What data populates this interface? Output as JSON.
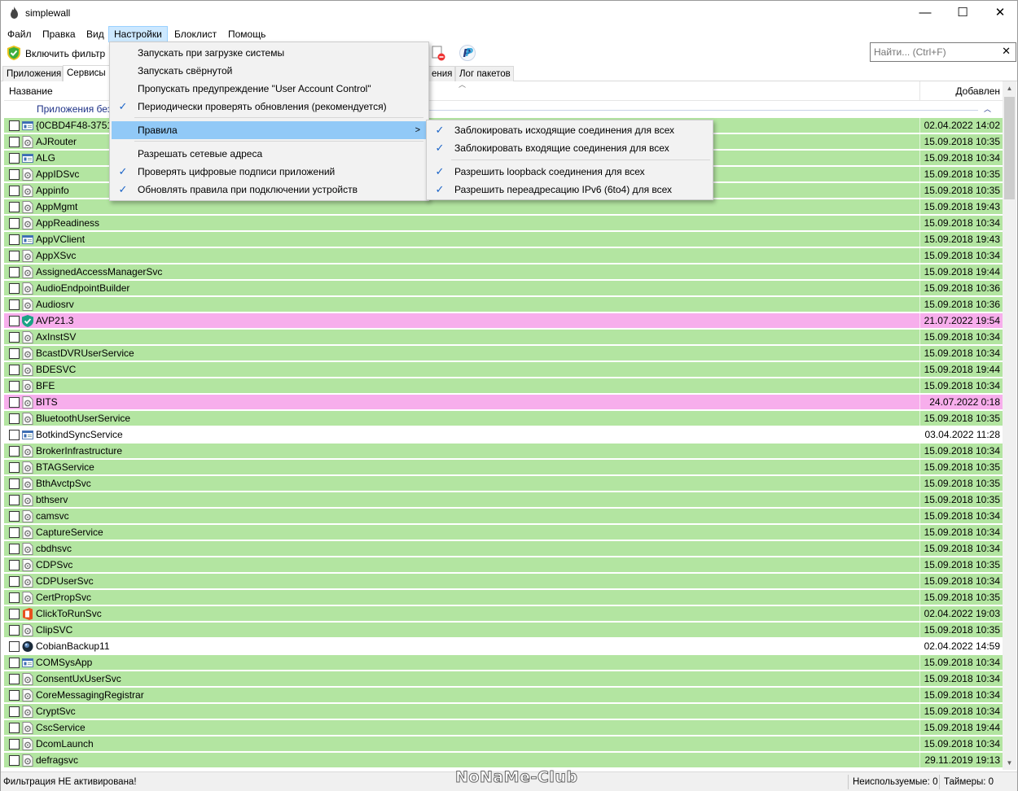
{
  "window": {
    "title": "simplewall",
    "minimize": "—",
    "maximize": "☐",
    "close": "✕"
  },
  "menubar": {
    "items": [
      "Файл",
      "Правка",
      "Вид",
      "Настройки",
      "Блоклист",
      "Помощь"
    ]
  },
  "toolbar": {
    "enable_filter_label": "Включить фильтр",
    "search_placeholder": "Найти... (Ctrl+F)",
    "search_clear": "✕"
  },
  "tabs": [
    "Приложения",
    "Сервисы",
    "ения",
    "Лог пакетов"
  ],
  "list": {
    "col_name": "Название",
    "col_added": "Добавлен",
    "group_title": "Приложения без дос",
    "rows": [
      {
        "name": "{0CBD4F48-3751-",
        "date": "02.04.2022 14:02",
        "color": "green",
        "icon": "window-icon"
      },
      {
        "name": "AJRouter",
        "date": "15.09.2018 10:35",
        "color": "green",
        "icon": "service-icon"
      },
      {
        "name": "ALG",
        "date": "15.09.2018 10:34",
        "color": "green",
        "icon": "window-icon"
      },
      {
        "name": "AppIDSvc",
        "date": "15.09.2018 10:35",
        "color": "green",
        "icon": "service-icon"
      },
      {
        "name": "Appinfo",
        "date": "15.09.2018 10:35",
        "color": "green",
        "icon": "service-icon"
      },
      {
        "name": "AppMgmt",
        "date": "15.09.2018 19:43",
        "color": "green",
        "icon": "service-icon"
      },
      {
        "name": "AppReadiness",
        "date": "15.09.2018 10:34",
        "color": "green",
        "icon": "service-icon"
      },
      {
        "name": "AppVClient",
        "date": "15.09.2018 19:43",
        "color": "green",
        "icon": "window-icon"
      },
      {
        "name": "AppXSvc",
        "date": "15.09.2018 10:34",
        "color": "green",
        "icon": "service-icon"
      },
      {
        "name": "AssignedAccessManagerSvc",
        "date": "15.09.2018 19:44",
        "color": "green",
        "icon": "service-icon"
      },
      {
        "name": "AudioEndpointBuilder",
        "date": "15.09.2018 10:36",
        "color": "green",
        "icon": "service-icon"
      },
      {
        "name": "Audiosrv",
        "date": "15.09.2018 10:36",
        "color": "green",
        "icon": "service-icon"
      },
      {
        "name": "AVP21.3",
        "date": "21.07.2022 19:54",
        "color": "pink",
        "icon": "kaspersky-shield-icon"
      },
      {
        "name": "AxInstSV",
        "date": "15.09.2018 10:34",
        "color": "green",
        "icon": "service-icon"
      },
      {
        "name": "BcastDVRUserService",
        "date": "15.09.2018 10:34",
        "color": "green",
        "icon": "service-icon"
      },
      {
        "name": "BDESVC",
        "date": "15.09.2018 19:44",
        "color": "green",
        "icon": "service-icon"
      },
      {
        "name": "BFE",
        "date": "15.09.2018 10:34",
        "color": "green",
        "icon": "service-icon"
      },
      {
        "name": "BITS",
        "date": "24.07.2022 0:18",
        "color": "pink",
        "icon": "service-icon"
      },
      {
        "name": "BluetoothUserService",
        "date": "15.09.2018 10:35",
        "color": "green",
        "icon": "service-icon"
      },
      {
        "name": "BotkindSyncService",
        "date": "03.04.2022 11:28",
        "color": "white",
        "icon": "window-icon"
      },
      {
        "name": "BrokerInfrastructure",
        "date": "15.09.2018 10:34",
        "color": "green",
        "icon": "service-icon"
      },
      {
        "name": "BTAGService",
        "date": "15.09.2018 10:35",
        "color": "green",
        "icon": "service-icon"
      },
      {
        "name": "BthAvctpSvc",
        "date": "15.09.2018 10:35",
        "color": "green",
        "icon": "service-icon"
      },
      {
        "name": "bthserv",
        "date": "15.09.2018 10:35",
        "color": "green",
        "icon": "service-icon"
      },
      {
        "name": "camsvc",
        "date": "15.09.2018 10:34",
        "color": "green",
        "icon": "service-icon"
      },
      {
        "name": "CaptureService",
        "date": "15.09.2018 10:34",
        "color": "green",
        "icon": "service-icon"
      },
      {
        "name": "cbdhsvc",
        "date": "15.09.2018 10:34",
        "color": "green",
        "icon": "service-icon"
      },
      {
        "name": "CDPSvc",
        "date": "15.09.2018 10:35",
        "color": "green",
        "icon": "service-icon"
      },
      {
        "name": "CDPUserSvc",
        "date": "15.09.2018 10:34",
        "color": "green",
        "icon": "service-icon"
      },
      {
        "name": "CertPropSvc",
        "date": "15.09.2018 10:35",
        "color": "green",
        "icon": "service-icon"
      },
      {
        "name": "ClickToRunSvc",
        "date": "02.04.2022 19:03",
        "color": "green",
        "icon": "office-icon"
      },
      {
        "name": "ClipSVC",
        "date": "15.09.2018 10:35",
        "color": "green",
        "icon": "service-icon"
      },
      {
        "name": "CobianBackup11",
        "date": "02.04.2022 14:59",
        "color": "white",
        "icon": "cobian-icon"
      },
      {
        "name": "COMSysApp",
        "date": "15.09.2018 10:34",
        "color": "green",
        "icon": "window-icon"
      },
      {
        "name": "ConsentUxUserSvc",
        "date": "15.09.2018 10:34",
        "color": "green",
        "icon": "service-icon"
      },
      {
        "name": "CoreMessagingRegistrar",
        "date": "15.09.2018 10:34",
        "color": "green",
        "icon": "service-icon"
      },
      {
        "name": "CryptSvc",
        "date": "15.09.2018 10:34",
        "color": "green",
        "icon": "service-icon"
      },
      {
        "name": "CscService",
        "date": "15.09.2018 19:44",
        "color": "green",
        "icon": "service-icon"
      },
      {
        "name": "DcomLaunch",
        "date": "15.09.2018 10:34",
        "color": "green",
        "icon": "service-icon"
      },
      {
        "name": "defragsvc",
        "date": "29.11.2019 19:13",
        "color": "green",
        "icon": "service-icon"
      }
    ]
  },
  "settings_menu": {
    "items": [
      {
        "label": "Запускать при загрузке системы",
        "checked": false
      },
      {
        "label": "Запускать свёрнутой",
        "checked": false
      },
      {
        "label": "Пропускать предупреждение \"User Account Control\"",
        "checked": false
      },
      {
        "label": "Периодически проверять обновления (рекомендуется)",
        "checked": true
      },
      {
        "label": "Правила",
        "checked": false,
        "submenu": true,
        "arrow": ">"
      },
      {
        "label": "Разрешать сетевые адреса",
        "checked": false
      },
      {
        "label": "Проверять цифровые подписи приложений",
        "checked": true
      },
      {
        "label": "Обновлять правила при подключении устройств",
        "checked": true
      }
    ],
    "check_glyph": "✓"
  },
  "rules_submenu": {
    "items": [
      {
        "label": "Заблокировать исходящие соединения для всех",
        "checked": true
      },
      {
        "label": "Заблокировать входящие соединения для всех",
        "checked": true
      },
      {
        "label": "Разрешить loopback соединения для всех",
        "checked": true
      },
      {
        "label": "Разрешить переадресацию IPv6 (6to4) для всех",
        "checked": true
      }
    ]
  },
  "statusbar": {
    "filter_status": "Фильтрация НЕ активирована!",
    "unused": "Неиспользуемые: 0",
    "timers": "Таймеры: 0"
  },
  "watermark": "NoNaMe-Club",
  "colors": {
    "green": "#b3e5a1",
    "pink": "#f7aeec",
    "white": "#ffffff",
    "menu_highlight": "#91c9f7",
    "check": "#1b64c8"
  }
}
